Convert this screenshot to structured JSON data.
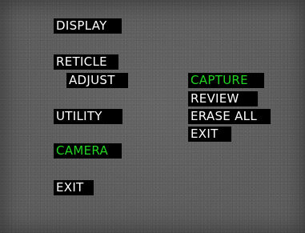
{
  "main_menu": {
    "items": [
      {
        "label": "DISPLAY",
        "selected": false
      },
      {
        "label": "RETICLE",
        "selected": false
      },
      {
        "label": "ADJUST",
        "selected": false
      },
      {
        "label": "UTILITY",
        "selected": false
      },
      {
        "label": "CAMERA",
        "selected": true
      },
      {
        "label": "EXIT",
        "selected": false
      }
    ]
  },
  "camera_submenu": {
    "items": [
      {
        "label": "CAPTURE",
        "selected": true
      },
      {
        "label": "REVIEW",
        "selected": false
      },
      {
        "label": "ERASE ALL",
        "selected": false
      },
      {
        "label": "EXIT",
        "selected": false
      }
    ]
  },
  "colors": {
    "background": "#5c5c5c",
    "item_background": "#000000",
    "text": "#ffffff",
    "selected_text": "#22d422"
  }
}
